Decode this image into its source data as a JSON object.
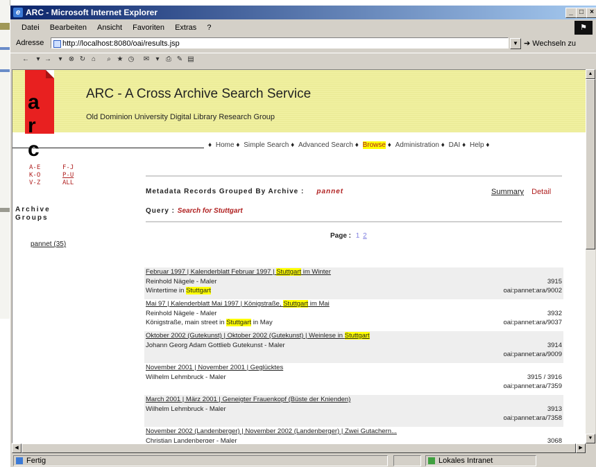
{
  "window": {
    "title": "ARC - Microsoft Internet Explorer",
    "controls": [
      "_",
      "□",
      "×"
    ]
  },
  "menu": [
    "Datei",
    "Bearbeiten",
    "Ansicht",
    "Favoriten",
    "Extras",
    "?"
  ],
  "address": {
    "label": "Adresse",
    "url": "http://localhost:8080/oai/results.jsp",
    "go_label": "Wechseln zu"
  },
  "status": {
    "left": "Fertig",
    "right": "Lokales Intranet"
  },
  "site": {
    "logo": "a r c",
    "title": "ARC - A Cross Archive Search Service",
    "subtitle": "Old Dominion University Digital Library Research Group",
    "nav": [
      {
        "label": "Home",
        "active": false
      },
      {
        "label": "Simple Search",
        "active": false
      },
      {
        "label": "Advanced Search",
        "active": false
      },
      {
        "label": "Browse",
        "active": true
      },
      {
        "label": "Administration",
        "active": false
      },
      {
        "label": "DAI",
        "active": false
      },
      {
        "label": "Help",
        "active": false
      }
    ],
    "nav_bullet": "♦",
    "letters": [
      [
        "A-E",
        "F-J"
      ],
      [
        "K-O",
        "P-U"
      ],
      [
        "V-Z",
        "ALL"
      ]
    ],
    "archive_groups_label": [
      "Archive",
      "Groups"
    ],
    "archive_link": "pannet (35)"
  },
  "results": {
    "heading": "Metadata Records Grouped By Archive :",
    "archive": "pannet",
    "summary_label": "Summary",
    "detail_label": "Detail",
    "query_label": "Query :",
    "query_text": "Search for Stuttgart",
    "page_label": "Page :",
    "pages": [
      "1",
      "2"
    ],
    "records": [
      {
        "title_pre": "Februar 1997 | Kalenderblatt Februar 1997 | ",
        "title_hl": "Stuttgart",
        "title_post": " im Winter",
        "author": "Reinhold Nägele - Maler",
        "desc_pre": "Wintertime in ",
        "desc_hl": "Stuttgart",
        "desc_post": "",
        "number": "3915",
        "oai": "oai:pannet:ara/9002",
        "alt": true
      },
      {
        "title_pre": "Mai 97 | Kalenderblatt Mai 1997 | Königstraße, ",
        "title_hl": "Stuttgart",
        "title_post": " im Mai",
        "author": "Reinhold Nägele - Maler",
        "desc_pre": "Königstraße, main street in ",
        "desc_hl": "Stuttgart",
        "desc_post": " in May",
        "number": "3932",
        "oai": "oai:pannet:ara/9037",
        "alt": false
      },
      {
        "title_pre": "Oktober 2002 (Gutekunst) | Oktober 2002 (Gutekunst) | Weinlese in ",
        "title_hl": "Stuttgart",
        "title_post": "",
        "author": "Johann Georg Adam Gottlieb Gutekunst - Maler",
        "desc_pre": "",
        "desc_hl": "",
        "desc_post": "",
        "number": "3914",
        "oai": "oai:pannet:ara/9009",
        "alt": true
      },
      {
        "title_pre": "November 2001 | November 2001 | Geglücktes",
        "title_hl": "",
        "title_post": "",
        "author": "Wilhelm Lehmbruck - Maler",
        "desc_pre": "",
        "desc_hl": "",
        "desc_post": "",
        "number": "3915 / 3916",
        "oai": "oai:pannet:ara/7359",
        "alt": false
      },
      {
        "title_pre": "March 2001 | März 2001 | Geneigter Frauenkopf (Büste der Knienden)",
        "title_hl": "",
        "title_post": "",
        "author": "Wilhelm Lehmbruck - Maler",
        "desc_pre": "",
        "desc_hl": "",
        "desc_post": "",
        "number": "3913",
        "oai": "oai:pannet:ara/7358",
        "alt": true
      },
      {
        "title_pre": "November 2002 (Landenberger) | November 2002 (Landenberger) | Zwei Gutachern...",
        "title_hl": "",
        "title_post": "",
        "author": "Christian Landenberger - Maler",
        "desc_pre": "",
        "desc_hl": "",
        "desc_post": "",
        "number": "3068",
        "oai": "",
        "alt": false
      }
    ]
  },
  "colors": {
    "title_bar": "#0a246a",
    "banner": "#f0f0a0",
    "logo_red": "#e82020",
    "accent_red": "#b02020",
    "highlight": "#ffff00"
  }
}
